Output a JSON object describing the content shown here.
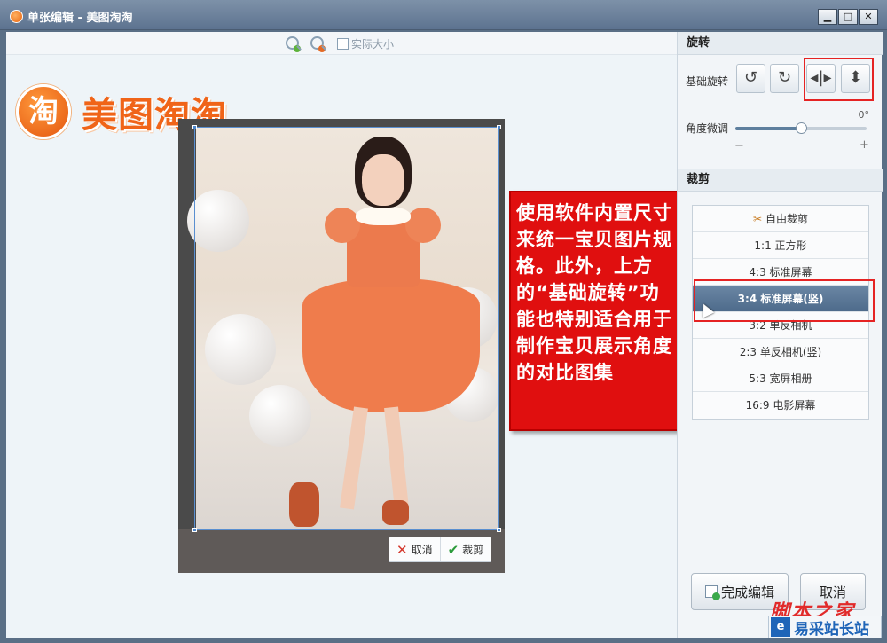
{
  "window": {
    "title": "单张编辑 - 美图淘淘",
    "minimize": "▁",
    "maximize": "□",
    "close": "✕"
  },
  "toolbar": {
    "actual_size": "实际大小"
  },
  "logo": {
    "mark": "淘",
    "text": "美图淘淘"
  },
  "crop_actions": {
    "cancel": "取消",
    "confirm": "裁剪"
  },
  "annotation": {
    "text": "使用软件内置尺寸来统一宝贝图片规格。此外，上方的“基础旋转”功能也特别适合用于制作宝贝展示角度的对比图集"
  },
  "panel": {
    "rotate_section": "旋转",
    "basic_rotate_label": "基础旋转",
    "fine_tune_label": "角度微调",
    "angle_value": "0°",
    "minus": "−",
    "plus": "+",
    "crop_section": "裁剪",
    "crop_options": [
      "自由裁剪",
      "1:1 正方形",
      "4:3 标准屏幕",
      "3:4 标准屏幕(竖)",
      "3:2 单反相机",
      "2:3 单反相机(竖)",
      "5:3 宽屏相册",
      "16:9 电影屏幕"
    ],
    "active_index": 3,
    "done_button": "完成编辑",
    "cancel_button": "取消"
  },
  "watermark": {
    "top": "脚本之家",
    "bottom": "易采站长站",
    "bottom_icon": "e"
  },
  "colors": {
    "title_bar": "#6b7f98",
    "annotation_red": "#e00f0f",
    "highlight_box": "#e52323",
    "active_item": "#5a7696"
  }
}
